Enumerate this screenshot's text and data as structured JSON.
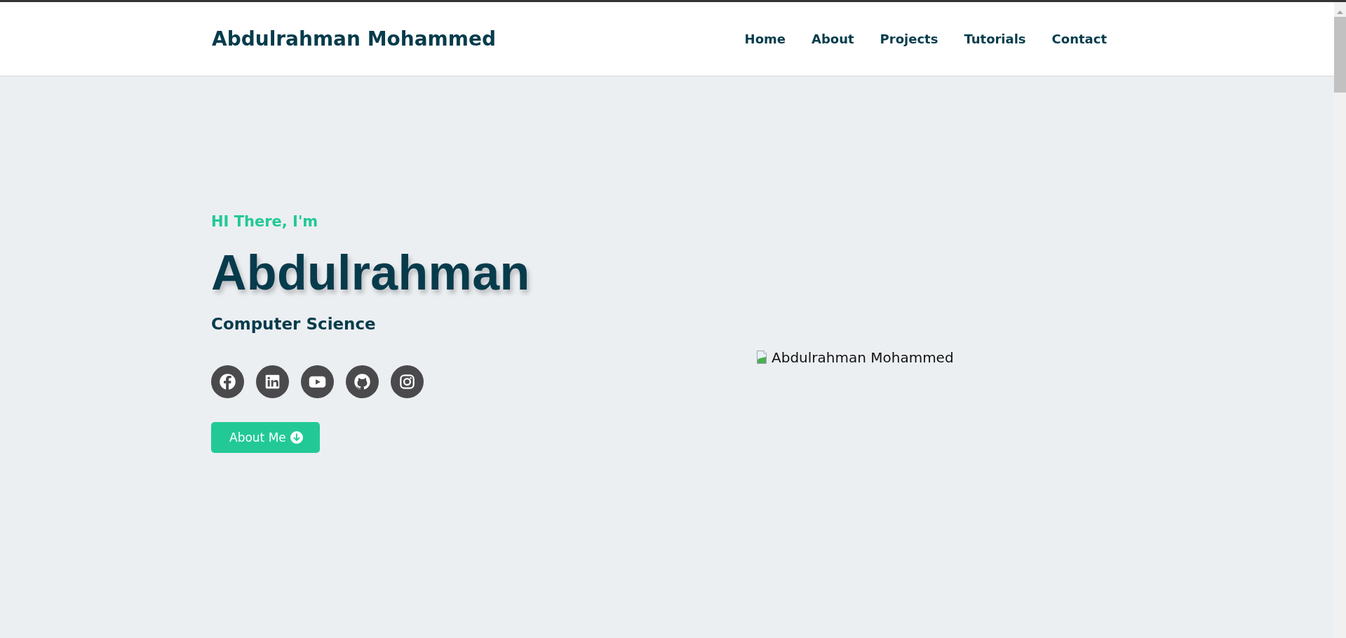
{
  "header": {
    "logo": "Abdulrahman Mohammed",
    "nav": [
      {
        "label": "Home"
      },
      {
        "label": "About"
      },
      {
        "label": "Projects"
      },
      {
        "label": "Tutorials"
      },
      {
        "label": "Contact"
      }
    ]
  },
  "hero": {
    "greeting": "HI There, I'm",
    "name": "Abdulrahman",
    "subtitle": "Computer Science",
    "social_links": [
      {
        "kind": "facebook"
      },
      {
        "kind": "linkedin"
      },
      {
        "kind": "youtube"
      },
      {
        "kind": "github"
      },
      {
        "kind": "instagram"
      }
    ],
    "button": {
      "label": "About Me"
    },
    "image": {
      "alt": "Abdulrahman Mohammed"
    }
  }
}
